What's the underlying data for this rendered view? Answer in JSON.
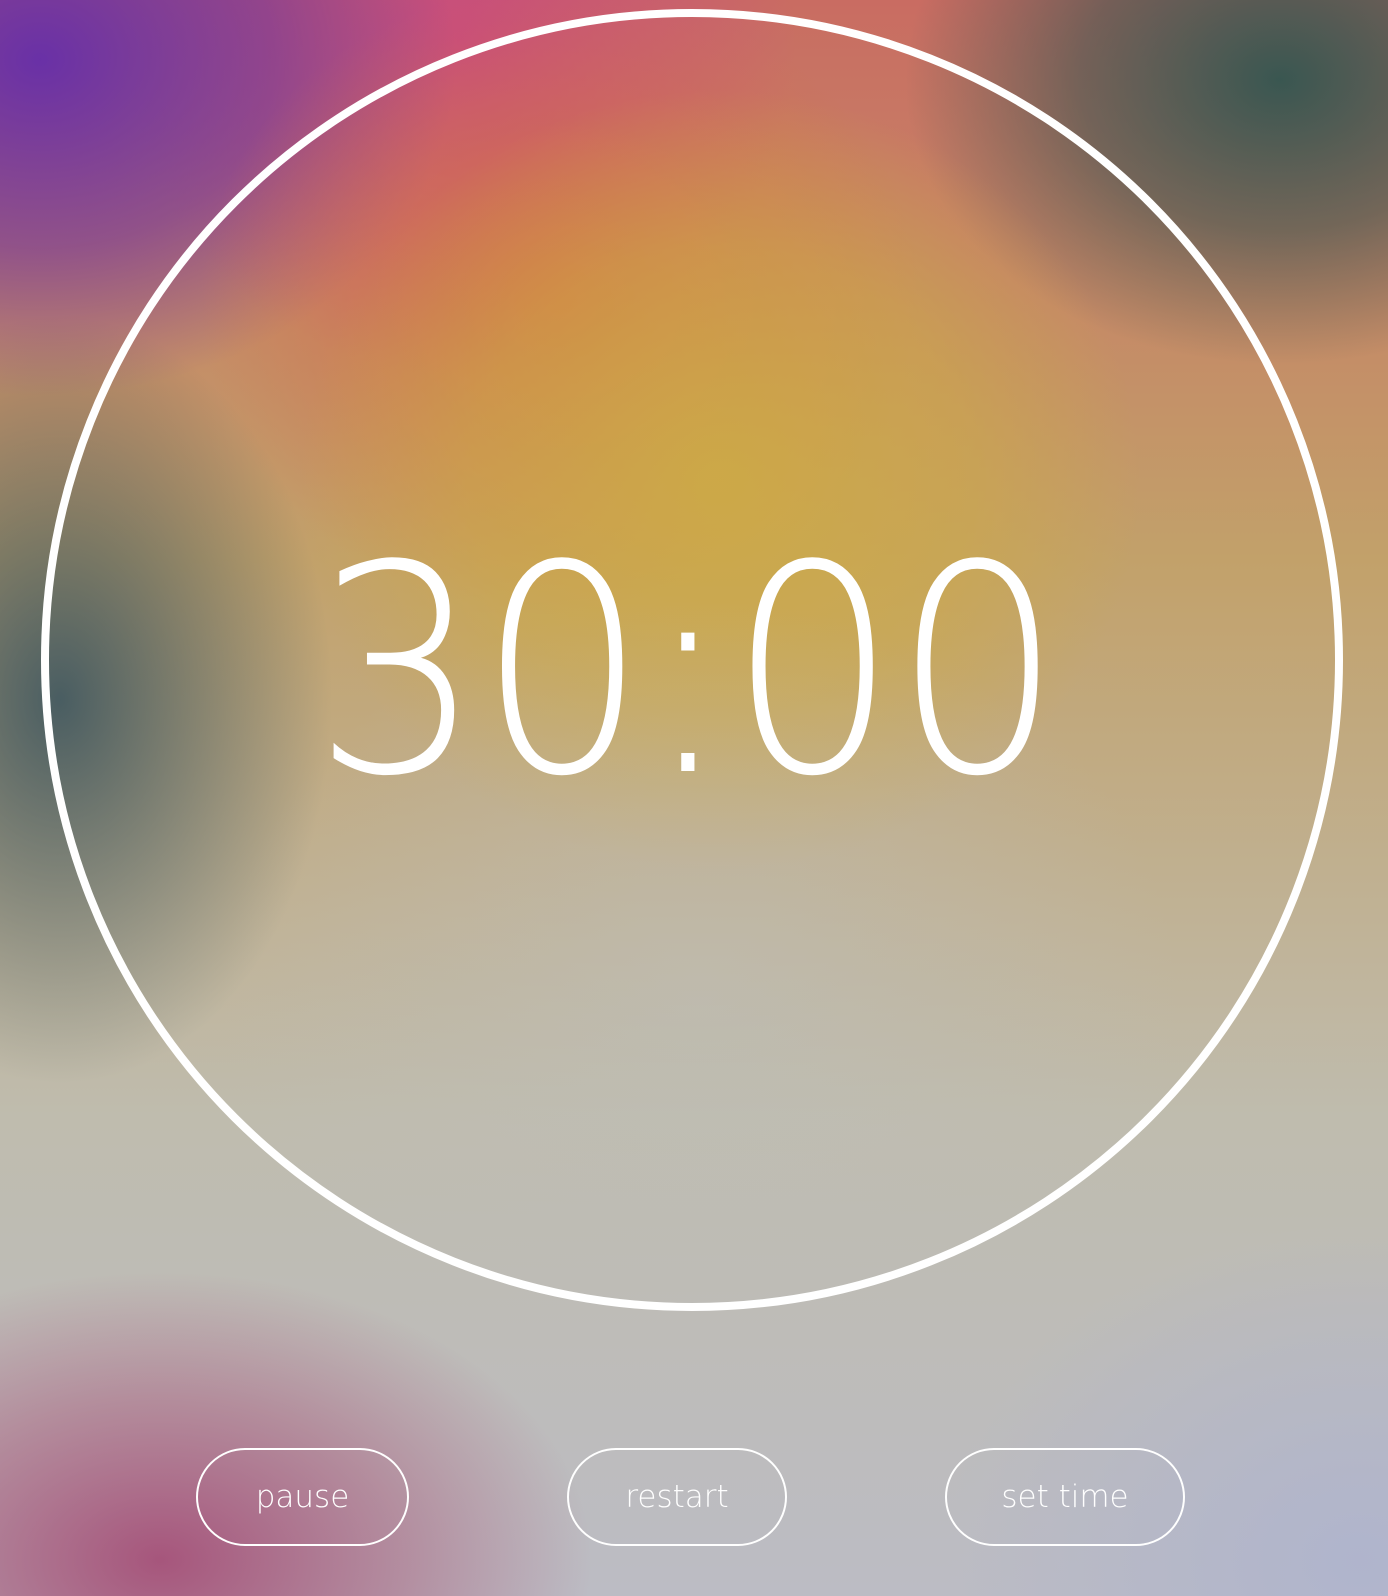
{
  "timer": {
    "display": "30:00"
  },
  "controls": {
    "pause_label": "pause",
    "restart_label": "restart",
    "set_time_label": "set time"
  },
  "colors": {
    "foreground": "#ffffff",
    "gradient_purple": "#6a32aa",
    "gradient_orange": "#d46e46",
    "gradient_gold": "#cdaa46",
    "gradient_teal": "#325550",
    "gradient_grey": "#bcbcc4"
  }
}
